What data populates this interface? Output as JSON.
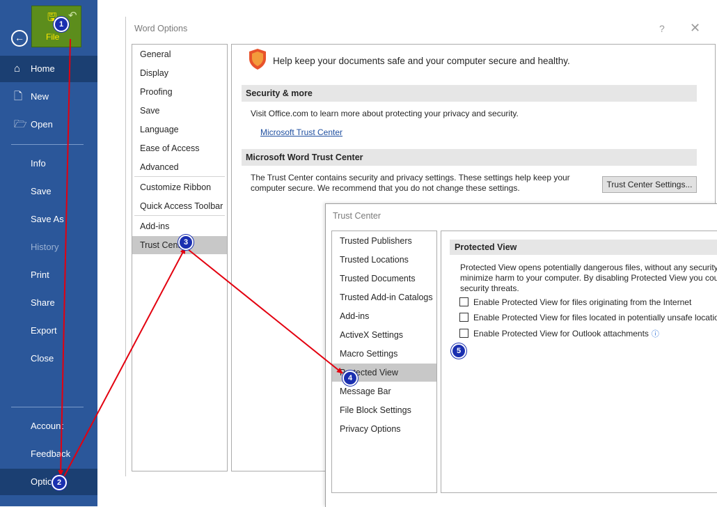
{
  "backstage": {
    "file_label": "File",
    "save_icon": "save-icon",
    "undo_icon": "undo-icon",
    "items": [
      {
        "label": "Home",
        "icon": "home-icon"
      },
      {
        "label": "New",
        "icon": "new-document-icon"
      },
      {
        "label": "Open",
        "icon": "open-folder-icon"
      },
      {
        "label": "Info"
      },
      {
        "label": "Save"
      },
      {
        "label": "Save As"
      },
      {
        "label": "History"
      },
      {
        "label": "Print"
      },
      {
        "label": "Share"
      },
      {
        "label": "Export"
      },
      {
        "label": "Close"
      },
      {
        "label": "Account"
      },
      {
        "label": "Feedback"
      },
      {
        "label": "Options"
      }
    ]
  },
  "word_options": {
    "title": "Word Options",
    "help_glyph": "?",
    "close_glyph": "✕",
    "nav": [
      "General",
      "Display",
      "Proofing",
      "Save",
      "Language",
      "Ease of Access",
      "Advanced",
      "Customize Ribbon",
      "Quick Access Toolbar",
      "Add-ins",
      "Trust Center"
    ],
    "header": "Help keep your documents safe and your computer secure and healthy.",
    "security_section": "Security & more",
    "security_text": "Visit Office.com to learn more about protecting your privacy and security.",
    "trust_center_link": "Microsoft Trust Center",
    "trust_center_section": "Microsoft Word Trust Center",
    "trust_center_text": "The Trust Center contains security and privacy settings. These settings help keep your computer secure. We recommend that you do not change these settings.",
    "trust_center_button": "Trust Center Settings..."
  },
  "trust_center": {
    "title": "Trust Center",
    "nav": [
      "Trusted Publishers",
      "Trusted Locations",
      "Trusted Documents",
      "Trusted Add-in Catalogs",
      "Add-ins",
      "ActiveX Settings",
      "Macro Settings",
      "Protected View",
      "Message Bar",
      "File Block Settings",
      "Privacy Options"
    ],
    "section_title": "Protected View",
    "description_lines": [
      "Protected View opens potentially dangerous files, without any security",
      "minimize harm to your computer. By disabling Protected View you cou",
      "security threats."
    ],
    "checkboxes": [
      {
        "label": "Enable Protected View for files originating from the Internet",
        "checked": false
      },
      {
        "label": "Enable Protected View for files located in potentially unsafe locatio",
        "checked": false
      },
      {
        "label": "Enable Protected View for Outlook attachments",
        "checked": false
      }
    ]
  },
  "annotations": {
    "markers": [
      "1",
      "2",
      "3",
      "4",
      "5"
    ],
    "arrow_color": "#e3000f",
    "marker_color": "#1a2fb0"
  },
  "colors": {
    "backstage_bg": "#2b579a",
    "file_tab_bg": "#5c8d1c",
    "selected_nav": "#c8c8c8",
    "link": "#1f4fa0",
    "shield": "#e8532b"
  }
}
